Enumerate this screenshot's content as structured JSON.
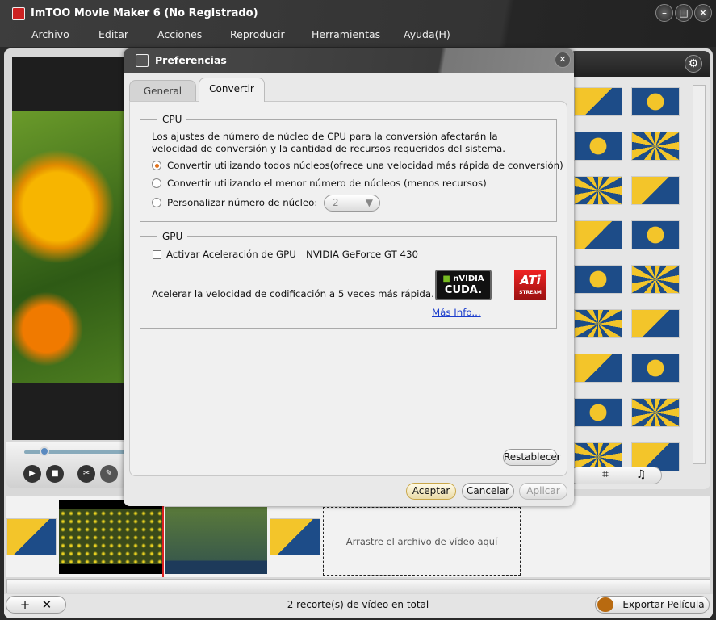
{
  "app": {
    "title": "ImTOO Movie Maker 6 (No Registrado)",
    "window_buttons": [
      "minimize-icon",
      "maximize-icon",
      "close-icon"
    ]
  },
  "menu": [
    "Archivo",
    "Editar",
    "Acciones",
    "Reproducir",
    "Herramientas",
    "Ayuda(H)"
  ],
  "dialog": {
    "title": "Preferencias",
    "tabs": [
      {
        "label": "General",
        "active": false
      },
      {
        "label": "Convertir",
        "active": true
      }
    ],
    "cpu": {
      "label": "CPU",
      "description_1": "Los ajustes de número de núcleo de CPU para la conversión afectarán la",
      "description_2": "velocidad de conversión y la cantidad de recursos requeridos del sistema.",
      "options": [
        {
          "label": "Convertir utilizando todos núcleos(ofrece una velocidad más rápida de conversión)",
          "selected": true
        },
        {
          "label": "Convertir utilizando el menor número de núcleos (menos recursos)",
          "selected": false
        },
        {
          "label": "Personalizar número de núcleo:",
          "selected": false
        }
      ],
      "core_count": "2"
    },
    "gpu": {
      "label": "GPU",
      "checkbox_label": "Activar Aceleración de GPU",
      "checked": false,
      "gpu_name": "NVIDIA GeForce GT 430",
      "accel_text": "Acelerar  la velocidad de codificación a 5 veces más rápida.",
      "more_info": "Más Info...",
      "nvidia_logo": "NVIDIA CUDA.",
      "ati_logo": "ATI STREAM TECHNOLOGY"
    },
    "reset": "Restablecer",
    "ok": "Aceptar",
    "cancel": "Cancelar",
    "apply": "Aplicar"
  },
  "timeline": {
    "drop_hint": "Arrastre el archivo de vídeo aquí"
  },
  "status": "2 recorte(s) de vídeo en total",
  "export": "Exportar Película",
  "colors": {
    "accent": "#e0701a",
    "link": "#1a3ccc",
    "tile_yellow": "#f3c52a",
    "tile_blue": "#1d4c88"
  }
}
